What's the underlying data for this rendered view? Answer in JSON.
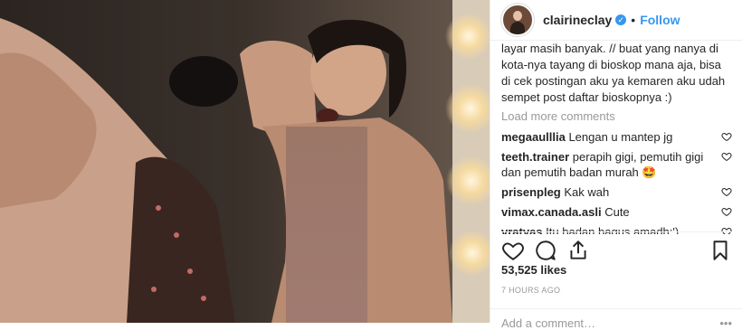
{
  "post": {
    "username": "clairineclay",
    "verified_mark": "✓",
    "separator": "•",
    "follow_label": "Follow"
  },
  "caption": "layar masih banyak. // buat yang nanya di kota-nya tayang di bioskop mana aja, bisa di cek postingan aku ya kemaren aku udah sempet post daftar bioskopnya :)",
  "load_more": "Load more comments",
  "comments": [
    {
      "user": "megaaulllia",
      "text": "Lengan u mantep jg"
    },
    {
      "user": "teeth.trainer",
      "text": "perapih gigi, pemutih gigi dan pemutih badan murah 🤩"
    },
    {
      "user": "prisenpleg",
      "text": "Kak wah"
    },
    {
      "user": "vimax.canada.asli",
      "text": "Cute"
    },
    {
      "user": "vratyas",
      "text": "Itu badan bagus amadh:')"
    }
  ],
  "likes": "53,525 likes",
  "time_ago": "7 HOURS AGO",
  "add_comment_placeholder": "Add a comment…",
  "more_glyph": "•••",
  "icons": {
    "like": "heart-icon",
    "comment": "comment-icon",
    "share": "share-icon",
    "save": "bookmark-icon"
  }
}
